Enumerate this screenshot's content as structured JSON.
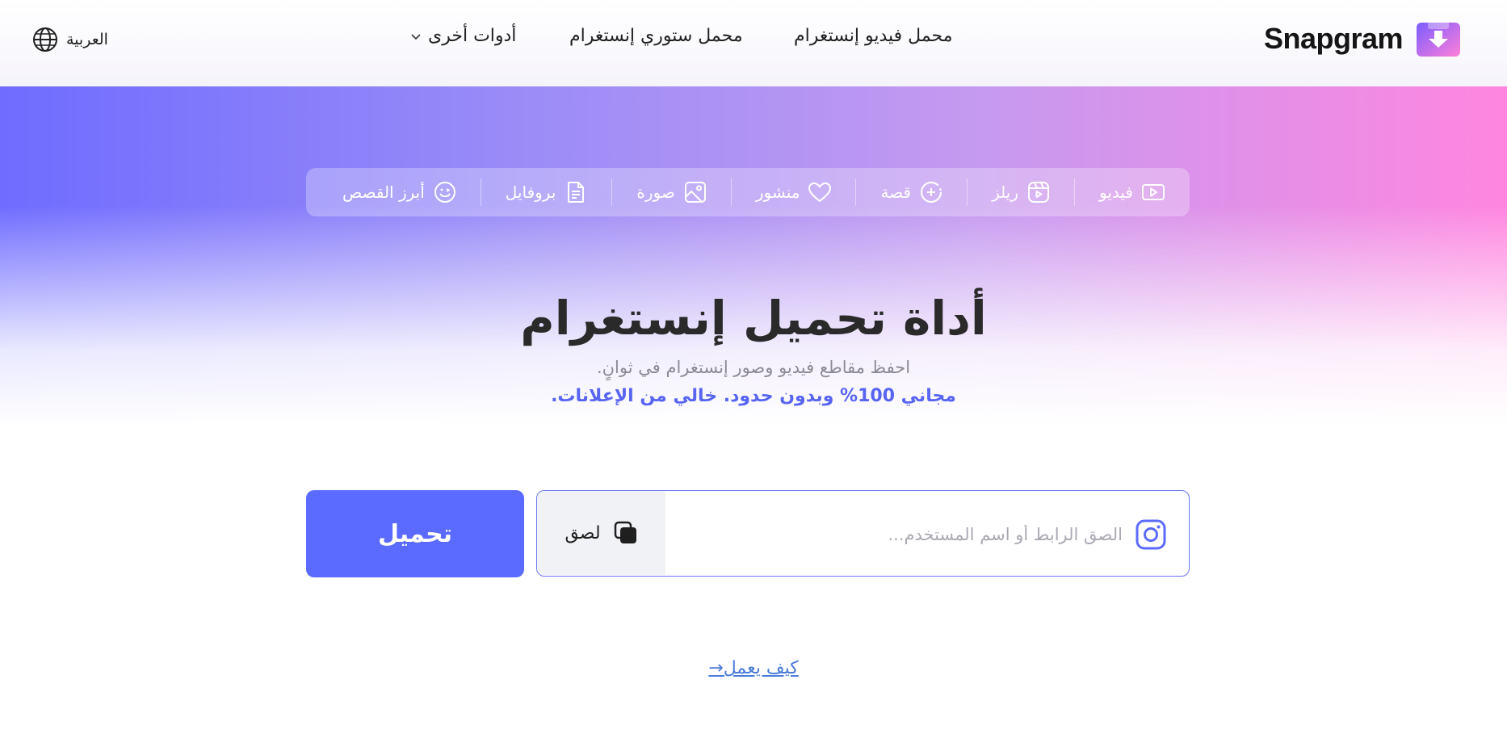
{
  "header": {
    "brand": "Snapgram",
    "nav": {
      "video_downloader": "محمل فيديو إنستغرام",
      "story_downloader": "محمل ستوري إنستغرام",
      "other_tools": "أدوات أخرى"
    },
    "language": "العربية"
  },
  "tabs": [
    {
      "label": "فيديو",
      "icon": "video-play-icon"
    },
    {
      "label": "ريلز",
      "icon": "reels-icon"
    },
    {
      "label": "قصة",
      "icon": "story-add-icon"
    },
    {
      "label": "منشور",
      "icon": "heart-icon"
    },
    {
      "label": "صورة",
      "icon": "image-icon"
    },
    {
      "label": "بروفايل",
      "icon": "profile-document-icon"
    },
    {
      "label": "أبرز القصص",
      "icon": "highlights-smile-icon"
    }
  ],
  "hero": {
    "title": "أداة تحميل إنستغرام",
    "subtitle": "احفظ مقاطع فيديو وصور إنستغرام في ثوانٍ.",
    "promo": "مجاني 100% وبدون حدود. خالي من الإعلانات."
  },
  "input": {
    "placeholder": "الصق الرابط أو اسم المستخدم...",
    "value": "",
    "paste_label": "لصق"
  },
  "download_label": "تحميل",
  "how_it_works": "كيف يعمل→",
  "colors": {
    "accent": "#5b6bff",
    "promo_text": "#5865f2",
    "gradient_left": "#6f6cff",
    "gradient_right": "#ff86e0",
    "link": "#4a7bd9"
  }
}
